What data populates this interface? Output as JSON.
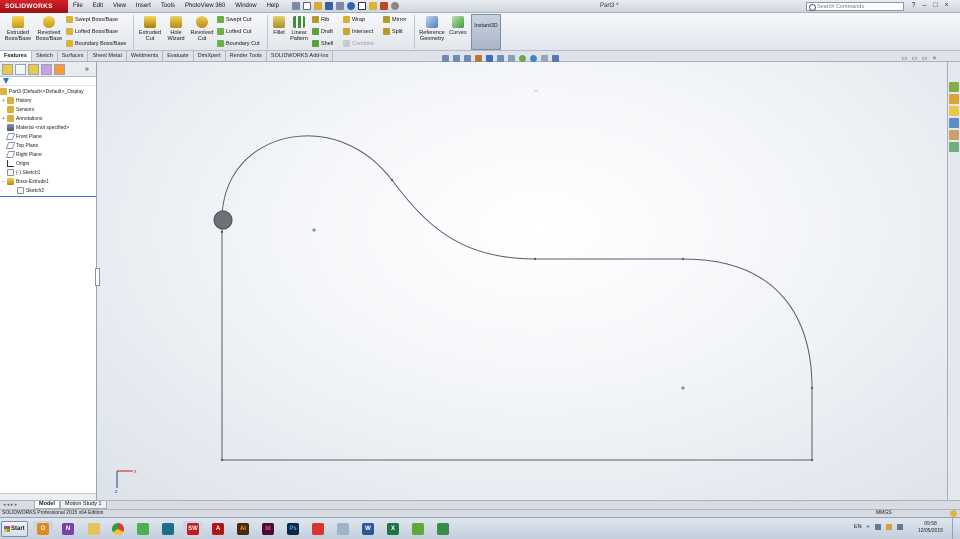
{
  "app": {
    "logo": "SOLIDWORKS",
    "document_title": "Part3 *",
    "search_placeholder": "Search Commands"
  },
  "menu": [
    "File",
    "Edit",
    "View",
    "Insert",
    "Tools",
    "PhotoView 360",
    "Window",
    "Help"
  ],
  "ribbon": {
    "extruded_boss": "Extruded Boss/Base",
    "revolved_boss": "Revolved Boss/Base",
    "swept_boss": "Swept Boss/Base",
    "lofted_boss": "Lofted Boss/Base",
    "boundary_boss": "Boundary Boss/Base",
    "extruded_cut": "Extruded Cut",
    "hole_wizard": "Hole Wizard",
    "revolved_cut": "Revolved Cut",
    "swept_cut": "Swept Cut",
    "lofted_cut": "Lofted Cut",
    "boundary_cut": "Boundary Cut",
    "fillet": "Fillet",
    "linear_pattern": "Linear Pattern",
    "rib": "Rib",
    "draft": "Draft",
    "shell": "Shell",
    "wrap": "Wrap",
    "intersect": "Intersect",
    "combine": "Combine",
    "mirror": "Mirror",
    "split": "Split",
    "reference_geometry": "Reference Geometry",
    "curves": "Curves",
    "instant3d": "Instant3D"
  },
  "tabs": [
    "Features",
    "Sketch",
    "Surfaces",
    "Sheet Metal",
    "Weldments",
    "Evaluate",
    "DimXpert",
    "Render Tools",
    "SOLIDWORKS Add-Ins"
  ],
  "tree": {
    "root": "Part3  (Default<<Default>_Display",
    "items": [
      "History",
      "Sensors",
      "Annotations",
      "Material <not specified>",
      "Front Plane",
      "Top Plane",
      "Right Plane",
      "Origin",
      "(-) Sketch1",
      "Boss-Extrude1",
      "Sketch2"
    ]
  },
  "model_tabs": [
    "Model",
    "Motion Study 1"
  ],
  "status": {
    "edition": "SOLIDWORKS Professional 2015 x64 Edition",
    "units": "MMGS"
  },
  "taskbar": {
    "start": "Start",
    "language": "EN",
    "time": "09:58",
    "date": "12/05/2015"
  },
  "colors": {
    "sketch_line": "#5a5d63",
    "accent": "#3d6fd6",
    "logo_red": "#c01a21"
  }
}
